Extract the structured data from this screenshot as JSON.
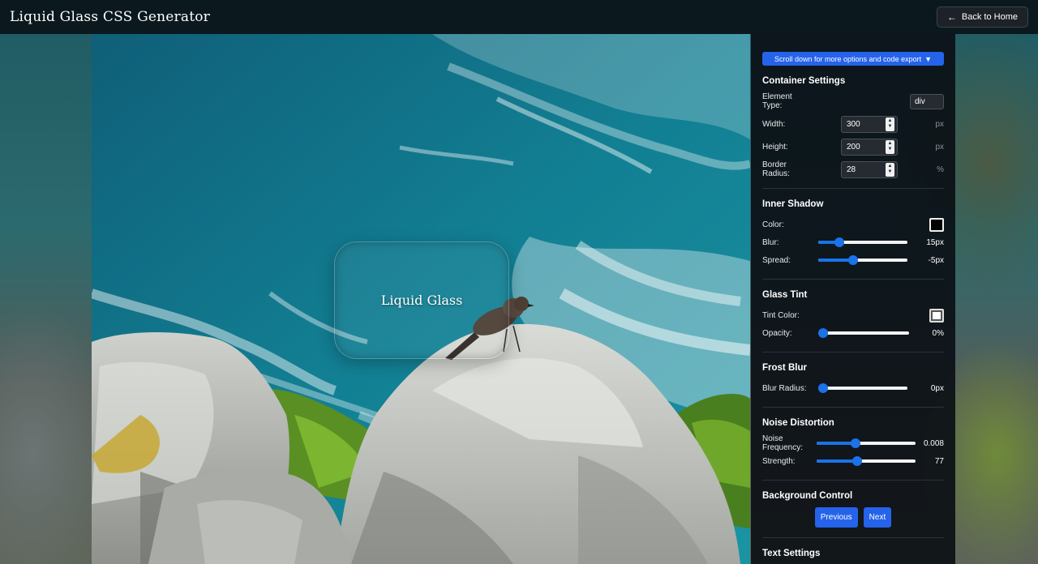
{
  "header": {
    "title": "Liquid Glass CSS Generator",
    "back_label": "Back to Home",
    "back_icon": "arrow-left-icon"
  },
  "preview": {
    "glass_text": "Liquid Glass"
  },
  "panel": {
    "scroll_hint": "Scroll down for more options and code export",
    "scroll_hint_icon": "▼",
    "container": {
      "title": "Container Settings",
      "element_type_label": "Element Type:",
      "element_type_value": "div",
      "width_label": "Width:",
      "width_value": "300",
      "width_unit": "px",
      "height_label": "Height:",
      "height_value": "200",
      "height_unit": "px",
      "radius_label": "Border Radius:",
      "radius_value": "28",
      "radius_unit": "%"
    },
    "inner_shadow": {
      "title": "Inner Shadow",
      "color_label": "Color:",
      "color_value": "#000000",
      "blur_label": "Blur:",
      "blur_value": "15px",
      "blur_fraction": 0.2,
      "spread_label": "Spread:",
      "spread_value": "-5px",
      "spread_fraction": 0.38
    },
    "glass_tint": {
      "title": "Glass Tint",
      "tint_label": "Tint Color:",
      "tint_value": "#ffffff",
      "opacity_label": "Opacity:",
      "opacity_value": "0%",
      "opacity_fraction": 0.0
    },
    "frost_blur": {
      "title": "Frost Blur",
      "radius_label": "Blur Radius:",
      "radius_value": "0px",
      "radius_fraction": 0.0
    },
    "noise": {
      "title": "Noise Distortion",
      "frequency_label": "Noise Frequency:",
      "frequency_value": "0.008",
      "frequency_fraction": 0.38,
      "strength_label": "Strength:",
      "strength_value": "77",
      "strength_fraction": 0.4
    },
    "background_control": {
      "title": "Background Control",
      "previous_label": "Previous",
      "next_label": "Next"
    },
    "text_settings": {
      "title": "Text Settings"
    }
  },
  "colors": {
    "accent": "#2563eb",
    "slider": "#1a73e8",
    "panel_bg": "#0a0e14"
  }
}
